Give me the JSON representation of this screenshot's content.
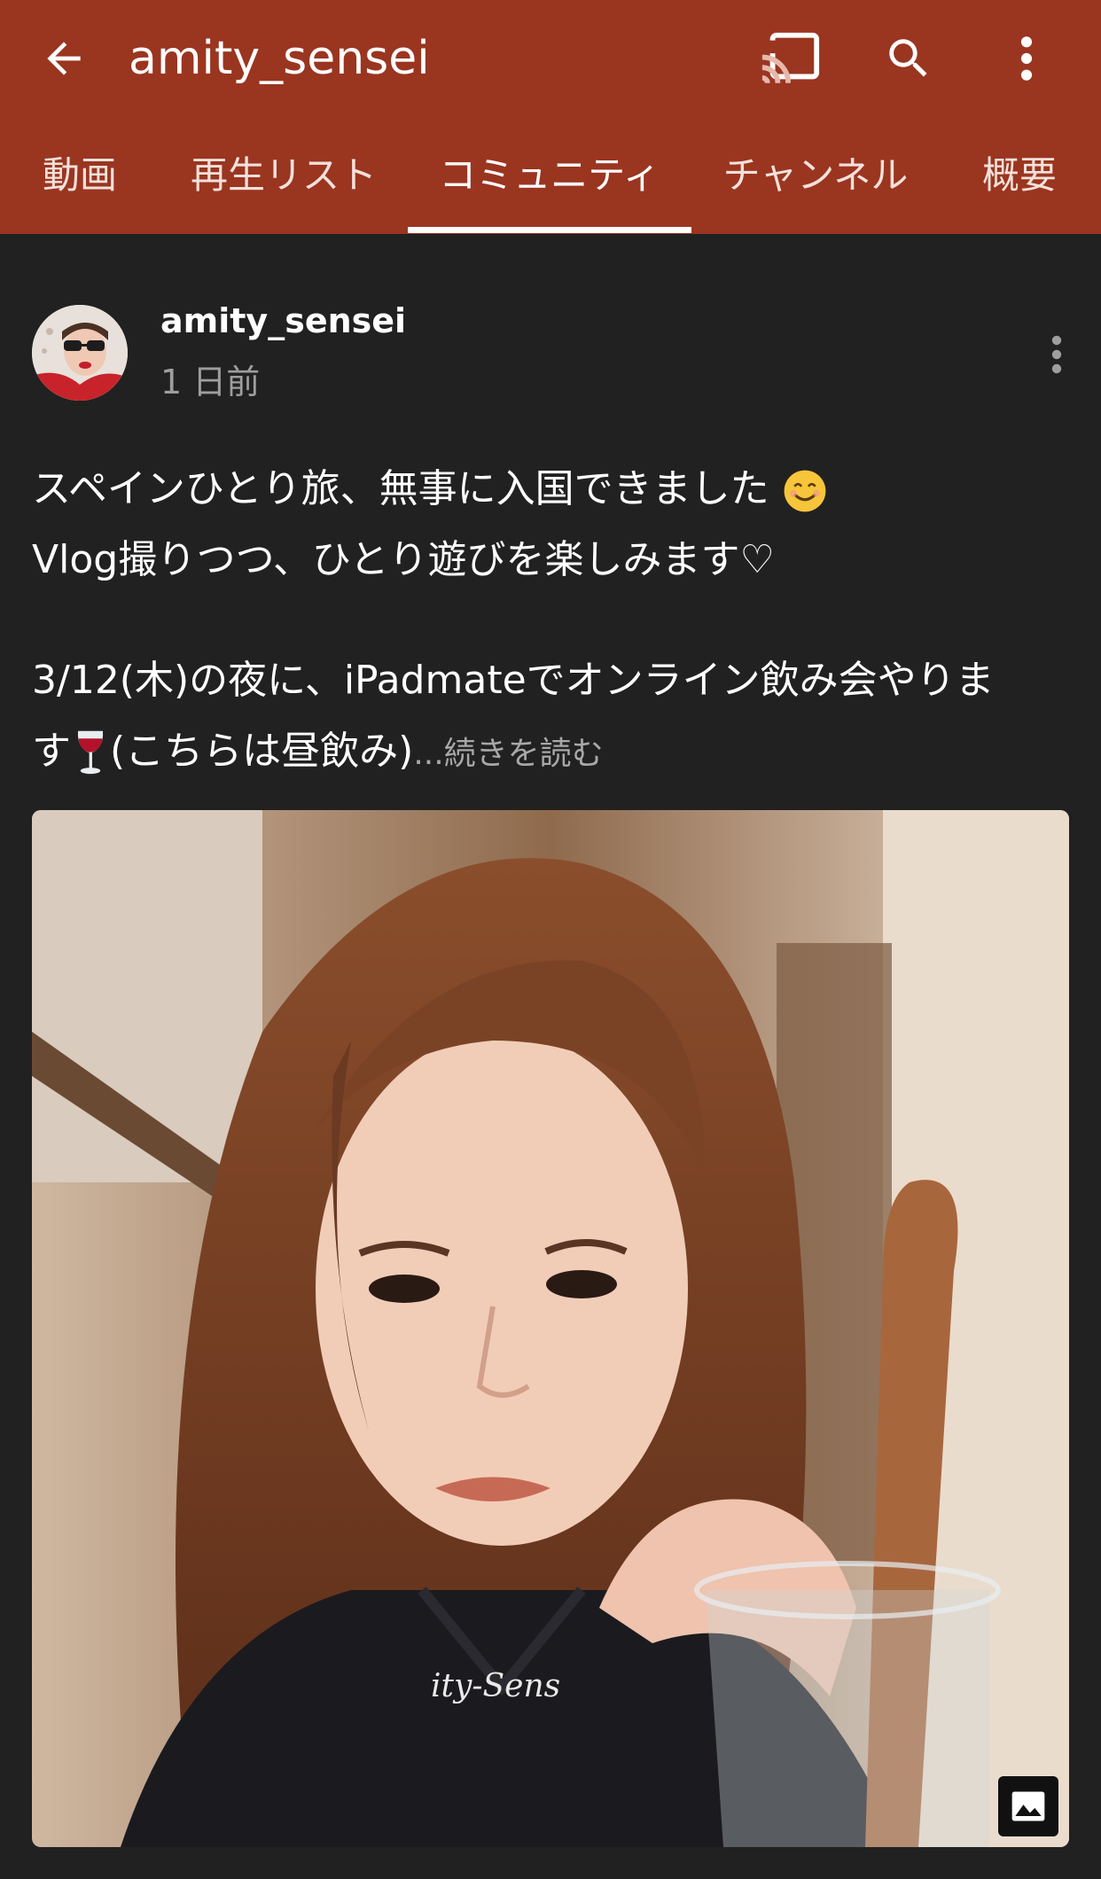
{
  "header": {
    "title": "amity_sensei",
    "back_icon": "arrow-back-icon",
    "cast_icon": "cast-icon",
    "search_icon": "search-icon",
    "more_icon": "more-vert-icon"
  },
  "tabs": [
    {
      "label": "動画"
    },
    {
      "label": "再生リスト"
    },
    {
      "label": "コミュニティ",
      "active": true
    },
    {
      "label": "チャンネル"
    },
    {
      "label": "概要"
    }
  ],
  "post": {
    "author": "amity_sensei",
    "time": "1 日前",
    "lines": [
      "スペインひとり旅、無事に入国できました",
      "Vlog撮りつつ、ひとり遊びを楽しみます♡",
      "3/12(木)の夜に、iPadmateでオンライン飲み会やりま",
      "す",
      "(こちらは昼飲み)"
    ],
    "read_more": "...続きを読む",
    "emoji_smile": "smiling-face-emoji",
    "emoji_wine": "wine-glass-emoji",
    "image_badge_icon": "image-icon"
  },
  "colors": {
    "appbar": "#9a3520",
    "background": "#212121",
    "text": "#ffffff",
    "secondary_text": "#9e9e9e"
  }
}
